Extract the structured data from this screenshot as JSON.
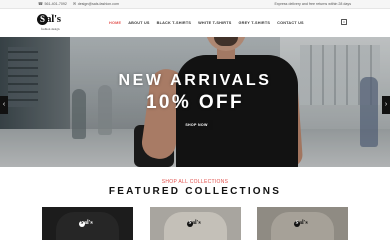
{
  "topbar": {
    "phone_icon": "phone-icon",
    "phone": "561-401-7092",
    "email_icon": "envelope-icon",
    "email": "design@sals-fashion.com",
    "shipping": "Express delivery and free returns within 28 days"
  },
  "header": {
    "logo_letter": "S",
    "logo_word": "al's",
    "logo_tagline": "fashion design",
    "nav": [
      {
        "label": "HOME",
        "active": true
      },
      {
        "label": "ABOUT US",
        "active": false
      },
      {
        "label": "BLACK T-SHIRTS",
        "active": false
      },
      {
        "label": "WHITE T-SHIRTS",
        "active": false
      },
      {
        "label": "GREY T-SHIRTS",
        "active": false
      },
      {
        "label": "CONTACT US",
        "active": false
      }
    ],
    "cart_icon": "shopping-bag-icon",
    "cart_count": "0"
  },
  "hero": {
    "title_line1": "NEW ARRIVALS",
    "title_line2": "10% OFF",
    "button_label": "SHOP NOW",
    "prev_icon": "chevron-left-icon",
    "next_icon": "chevron-right-icon"
  },
  "featured": {
    "link": "SHOP ALL COLLECTIONS",
    "title": "FEATURED COLLECTIONS",
    "cards": [
      {
        "logo_letter": "S",
        "logo_word": "al's",
        "color": "#1c1c1c"
      },
      {
        "logo_letter": "S",
        "logo_word": "al's",
        "color": "#c4c0b8"
      },
      {
        "logo_letter": "S",
        "logo_word": "al's",
        "color": "#a6a198"
      }
    ]
  },
  "colors": {
    "accent": "#e2504c",
    "button": "#111111"
  }
}
